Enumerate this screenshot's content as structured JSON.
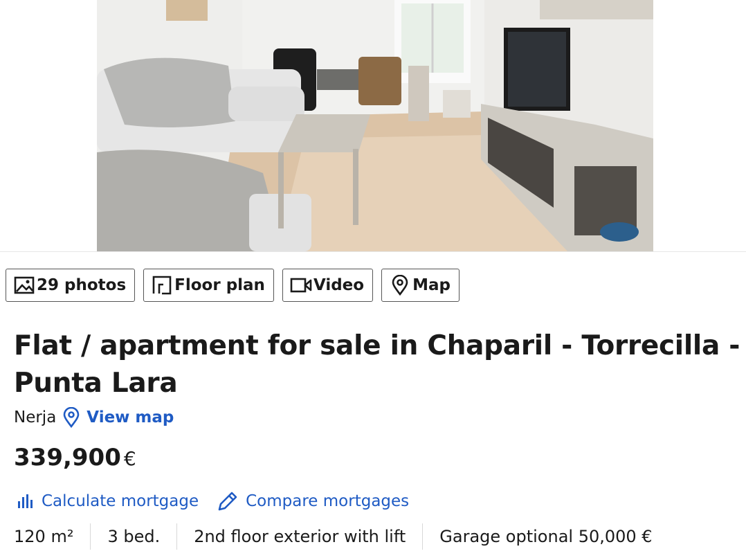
{
  "media_buttons": {
    "photos": {
      "label": "29 photos",
      "icon": "image-icon"
    },
    "floor_plan": {
      "label": "Floor plan",
      "icon": "floor-plan-icon"
    },
    "video": {
      "label": "Video",
      "icon": "video-icon"
    },
    "map": {
      "label": "Map",
      "icon": "map-pin-icon"
    }
  },
  "listing": {
    "title": "Flat / apartment for sale in Chaparil - Torrecilla - Punta Lara",
    "town": "Nerja",
    "view_map_label": "View map",
    "price": "339,900",
    "currency": "€"
  },
  "mortgage": {
    "calculate_label": "Calculate mortgage",
    "compare_label": "Compare mortgages"
  },
  "features": [
    "120 m²",
    "3 bed.",
    "2nd floor exterior with lift",
    "Garage optional 50,000 €"
  ],
  "colors": {
    "link": "#1f5bc4",
    "text": "#1a1a1a",
    "border": "#555555"
  }
}
